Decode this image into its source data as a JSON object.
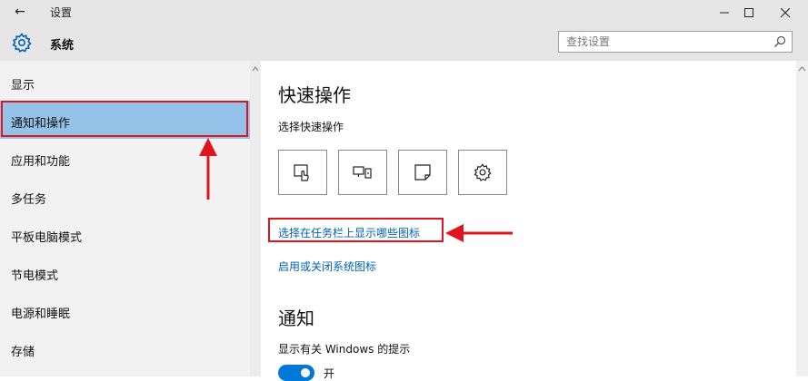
{
  "window": {
    "title": "设置",
    "back_icon": "←",
    "controls": [
      "minimize-icon",
      "maximize-icon",
      "close-icon"
    ]
  },
  "header": {
    "icon": "gear-icon",
    "title": "系统",
    "search": {
      "placeholder": "查找设置",
      "value": "",
      "icon": "search-icon"
    }
  },
  "sidebar": {
    "items": [
      {
        "label": "显示"
      },
      {
        "label": "通知和操作",
        "selected": true
      },
      {
        "label": "应用和功能"
      },
      {
        "label": "多任务"
      },
      {
        "label": "平板电脑模式"
      },
      {
        "label": "节电模式"
      },
      {
        "label": "电源和睡眠"
      },
      {
        "label": "存储"
      }
    ]
  },
  "main": {
    "quick_actions": {
      "title": "快速操作",
      "subtitle": "选择快速操作",
      "tiles": [
        {
          "icon": "tablet-mode-icon"
        },
        {
          "icon": "project-display-icon"
        },
        {
          "icon": "note-icon"
        },
        {
          "icon": "settings-gear-icon"
        }
      ],
      "link_taskbar_icons": "选择在任务栏上显示哪些图标",
      "link_system_icons": "启用或关闭系统图标"
    },
    "notifications": {
      "title": "通知",
      "option_text": "显示有关 Windows 的提示",
      "toggle": {
        "on": true,
        "label": "开"
      }
    }
  },
  "annotations": {
    "highlight_color": "#e0141e"
  },
  "colors": {
    "accent": "#0078d7",
    "link": "#0063b1",
    "selected_bg": "#94c2e8",
    "sidebar_bg": "#f2f2f2",
    "titlebar_bg": "#e6e6e6"
  }
}
